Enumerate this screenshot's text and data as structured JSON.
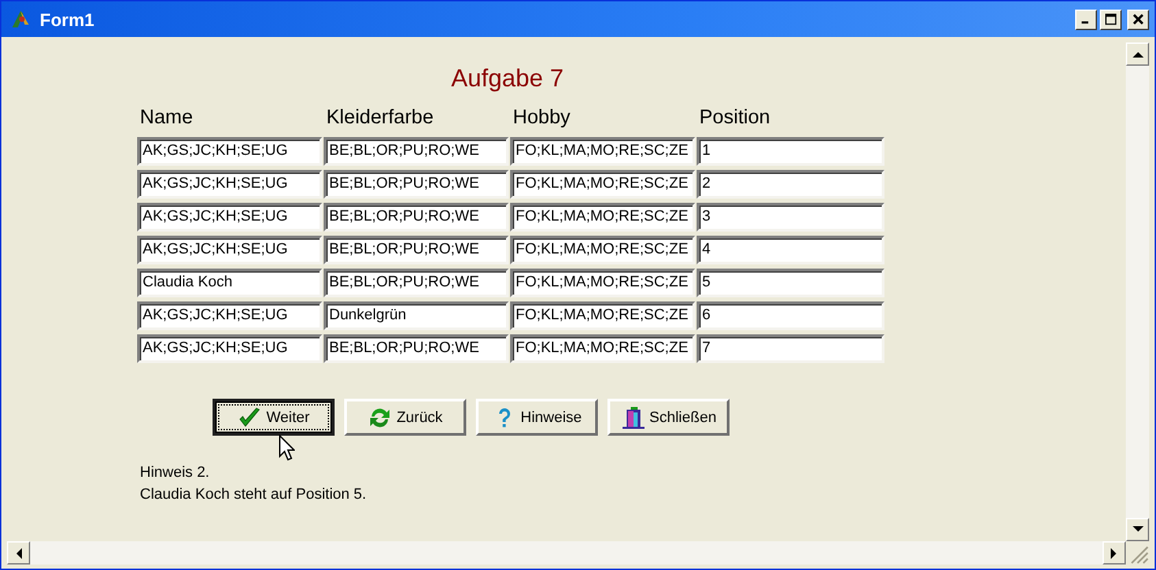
{
  "window": {
    "title": "Form1"
  },
  "heading": "Aufgabe 7",
  "columns": [
    "Name",
    "Kleiderfarbe",
    "Hobby",
    "Position"
  ],
  "rows": [
    [
      "AK;GS;JC;KH;SE;UG",
      "BE;BL;OR;PU;RO;WE",
      "FO;KL;MA;MO;RE;SC;ZE",
      "1"
    ],
    [
      "AK;GS;JC;KH;SE;UG",
      "BE;BL;OR;PU;RO;WE",
      "FO;KL;MA;MO;RE;SC;ZE",
      "2"
    ],
    [
      "AK;GS;JC;KH;SE;UG",
      "BE;BL;OR;PU;RO;WE",
      "FO;KL;MA;MO;RE;SC;ZE",
      "3"
    ],
    [
      "AK;GS;JC;KH;SE;UG",
      "BE;BL;OR;PU;RO;WE",
      "FO;KL;MA;MO;RE;SC;ZE",
      "4"
    ],
    [
      "Claudia Koch",
      "BE;BL;OR;PU;RO;WE",
      "FO;KL;MA;MO;RE;SC;ZE",
      "5"
    ],
    [
      "AK;GS;JC;KH;SE;UG",
      "Dunkelgrün",
      "FO;KL;MA;MO;RE;SC;ZE",
      "6"
    ],
    [
      "AK;GS;JC;KH;SE;UG",
      "BE;BL;OR;PU;RO;WE",
      "FO;KL;MA;MO;RE;SC;ZE",
      "7"
    ]
  ],
  "buttons": [
    {
      "label": "Weiter",
      "focused": true
    },
    {
      "label": "Zurück",
      "focused": false
    },
    {
      "label": "Hinweise",
      "focused": false
    },
    {
      "label": "Schließen",
      "focused": false
    }
  ],
  "hint_lines": [
    "Hinweis 2.",
    "Claudia Koch steht auf Position 5."
  ]
}
